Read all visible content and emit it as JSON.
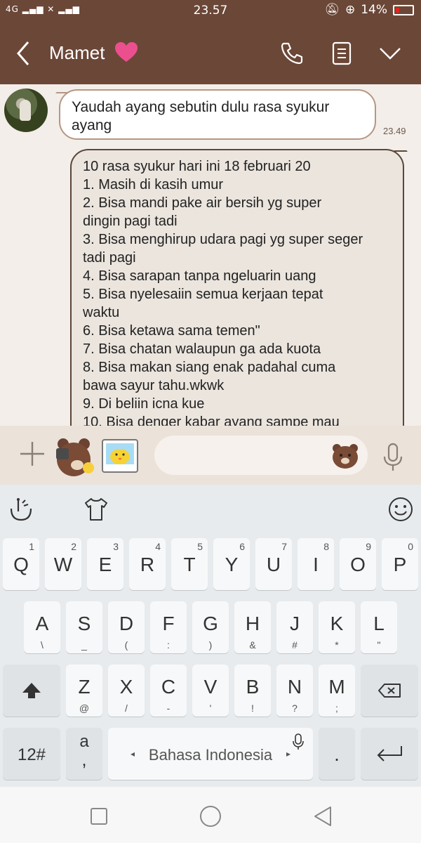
{
  "status": {
    "network": "4G",
    "time": "23.57",
    "battery": "14%"
  },
  "header": {
    "contact_name": "Mamet",
    "heart_color": "#ec4f8e"
  },
  "messages": {
    "incoming": {
      "text_lines": [
        "Yaudah ayang sebutin dulu rasa syukur",
        "ayang"
      ],
      "time": "23.49"
    },
    "outgoing": {
      "text_lines": [
        "10 rasa syukur hari ini 18 februari 20",
        "1. Masih di kasih umur",
        "2. Bisa mandi pake air bersih yg super",
        "dingin pagi tadi",
        "3. Bisa menghirup udara pagi yg super seger",
        "tadi pagi",
        "4. Bisa sarapan tanpa ngeluarin uang",
        "5. Bisa nyelesaiin semua kerjaan tepat",
        "waktu",
        "6. Bisa ketawa sama temen\"",
        "7. Bisa chatan walaupun ga ada kuota",
        "8. Bisa makan siang enak padahal cuma",
        "bawa sayur tahu.wkwk",
        "9. Di beliin icna kue",
        "10. Bisa denger kabar ayang sampe mau"
      ]
    }
  },
  "keyboard": {
    "row1": [
      {
        "main": "Q",
        "sub": "1"
      },
      {
        "main": "W",
        "sub": "2"
      },
      {
        "main": "E",
        "sub": "3"
      },
      {
        "main": "R",
        "sub": "4"
      },
      {
        "main": "T",
        "sub": "5"
      },
      {
        "main": "Y",
        "sub": "6"
      },
      {
        "main": "U",
        "sub": "7"
      },
      {
        "main": "I",
        "sub": "8"
      },
      {
        "main": "O",
        "sub": "9"
      },
      {
        "main": "P",
        "sub": "0"
      }
    ],
    "row2": [
      {
        "main": "A",
        "sub": "\\"
      },
      {
        "main": "S",
        "sub": "_"
      },
      {
        "main": "D",
        "sub": "("
      },
      {
        "main": "F",
        "sub": ":"
      },
      {
        "main": "G",
        "sub": ")"
      },
      {
        "main": "H",
        "sub": "&"
      },
      {
        "main": "J",
        "sub": "#"
      },
      {
        "main": "K",
        "sub": "*"
      },
      {
        "main": "L",
        "sub": "\""
      }
    ],
    "row3": [
      {
        "main": "Z",
        "sub": "@"
      },
      {
        "main": "X",
        "sub": "/"
      },
      {
        "main": "C",
        "sub": "-"
      },
      {
        "main": "V",
        "sub": "'"
      },
      {
        "main": "B",
        "sub": "!"
      },
      {
        "main": "N",
        "sub": "?"
      },
      {
        "main": "M",
        "sub": ";"
      }
    ],
    "numbers_key": "12#",
    "comma_key": {
      "main": "a",
      "sub": ","
    },
    "space_label": "Bahasa Indonesia",
    "period_key": "."
  }
}
